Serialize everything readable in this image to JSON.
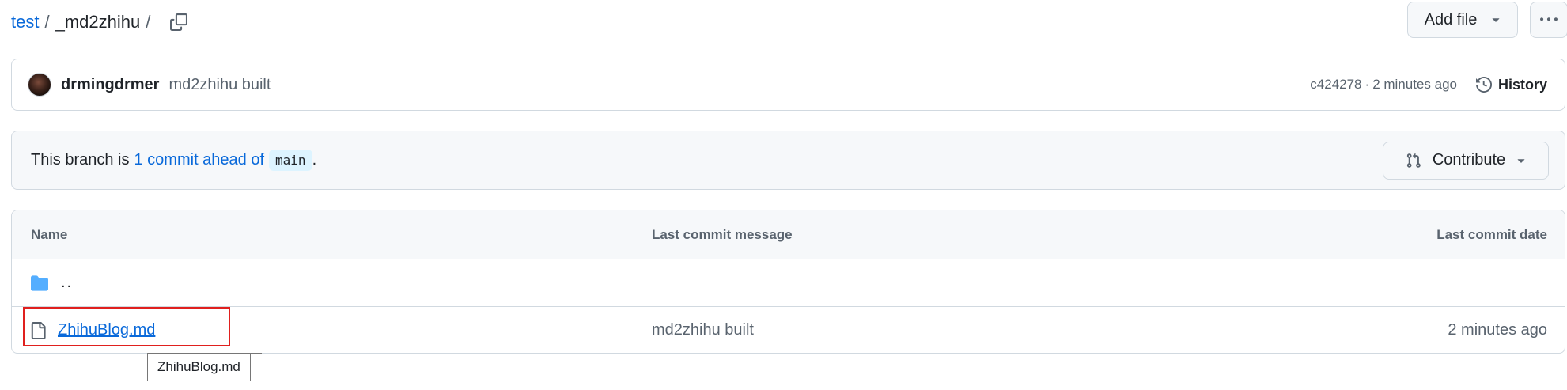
{
  "breadcrumb": {
    "repo": "test",
    "separator": "/",
    "folder": "_md2zhihu",
    "trailing_separator": "/"
  },
  "actions": {
    "add_file_label": "Add file"
  },
  "commit": {
    "author": "drmingdrmer",
    "message": "md2zhihu built",
    "sha": "c424278",
    "dot": "·",
    "time": "2 minutes ago",
    "history_label": "History"
  },
  "branch": {
    "prefix": "This branch is",
    "ahead_text": "1 commit ahead of",
    "base": "main",
    "suffix": ".",
    "contribute_label": "Contribute"
  },
  "table": {
    "headers": {
      "name": "Name",
      "message": "Last commit message",
      "date": "Last commit date"
    },
    "rows": [
      {
        "name": "..",
        "message": "",
        "date": ""
      },
      {
        "name": "ZhihuBlog.md",
        "message": "md2zhihu built",
        "date": "2 minutes ago"
      }
    ]
  },
  "tooltip": {
    "text": "ZhihuBlog.md"
  },
  "colors": {
    "link": "#0969da",
    "highlight": "#e0201e",
    "folder": "#54aeff"
  }
}
